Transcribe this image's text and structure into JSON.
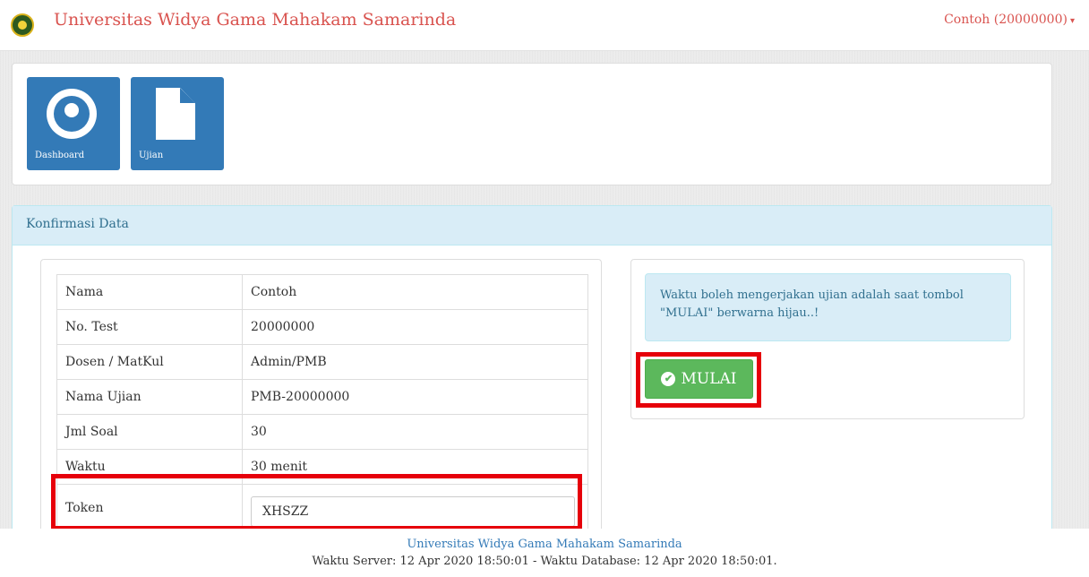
{
  "navbar": {
    "title": "Universitas Widya Gama Mahakam Samarinda",
    "user": "Contoh (20000000)",
    "caret": "▾"
  },
  "menu": {
    "tiles": [
      {
        "label": "Dashboard",
        "icon": "dashboard-icon"
      },
      {
        "label": "Ujian",
        "icon": "file-icon"
      }
    ]
  },
  "konfirmasi": {
    "heading": "Konfirmasi Data",
    "rows": [
      {
        "label": "Nama",
        "value": "Contoh"
      },
      {
        "label": "No. Test",
        "value": "20000000"
      },
      {
        "label": "Dosen / MatKul",
        "value": "Admin/PMB"
      },
      {
        "label": "Nama Ujian",
        "value": "PMB-20000000"
      },
      {
        "label": "Jml Soal",
        "value": "30"
      },
      {
        "label": "Waktu",
        "value": "30 menit"
      }
    ],
    "token": {
      "label": "Token",
      "value": "XHSZZ"
    },
    "alert": "Waktu boleh mengerjakan ujian adalah saat tombol \"MULAI\" berwarna hijau..!",
    "start_button": "MULAI",
    "check_glyph": "✔"
  },
  "footer": {
    "title": "Universitas Widya Gama Mahakam Samarinda",
    "time": "Waktu Server: 12 Apr 2020 18:50:01 - Waktu Database: 12 Apr 2020 18:50:01."
  },
  "colors": {
    "brand_red": "#d9534f",
    "primary_blue": "#337ab7",
    "info_bg": "#d9edf7",
    "success_green": "#5cb85c",
    "highlight_red": "#e6000a"
  }
}
